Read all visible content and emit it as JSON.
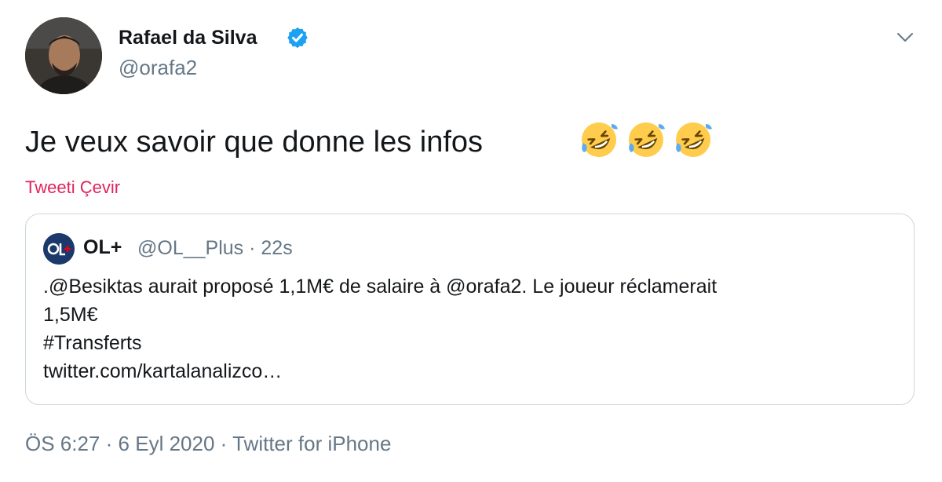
{
  "author": {
    "display_name": "Rafael da Silva",
    "handle": "@orafa2",
    "verified": true
  },
  "tweet": {
    "text": "Je veux savoir que donne les infos",
    "emojis": [
      "rolling-on-floor-laughing",
      "rolling-on-floor-laughing",
      "rolling-on-floor-laughing"
    ],
    "translate_label": "Tweeti Çevir"
  },
  "quoted_tweet": {
    "display_name": "OL+",
    "meta": "@OL__Plus · 22s",
    "lines": [
      ".@Besiktas aurait proposé 1,1M€ de salaire à @orafa2. Le joueur réclamerait",
      "1,5M€",
      "#Transferts",
      "twitter.com/kartalanalizco…"
    ]
  },
  "footer": {
    "time": "ÖS 6:27",
    "date": "6 Eyl 2020",
    "source": "Twitter for iPhone",
    "separator": "·"
  },
  "colors": {
    "text": "#14171a",
    "secondary": "#657786",
    "accent_pink": "#e0245e",
    "verified_blue": "#1da1f2",
    "border": "#ccd6dd"
  },
  "icons": {
    "verified": "verified-badge-icon",
    "menu": "chevron-down-icon"
  }
}
